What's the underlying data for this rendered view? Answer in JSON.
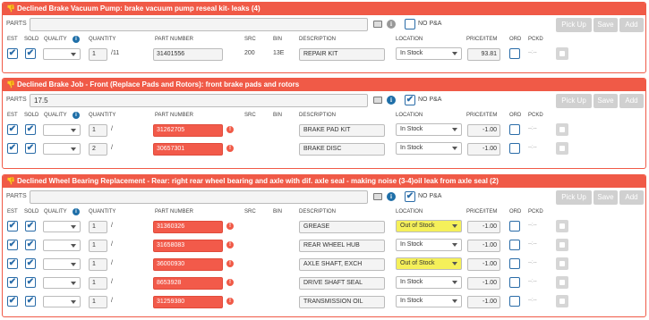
{
  "common": {
    "parts_label": "PARTS",
    "no_pa_label": "NO P&A",
    "pickup_label": "Pick Up",
    "save_label": "Save",
    "add_label": "Add",
    "col_est": "EST",
    "col_sold": "SOLD",
    "col_quality": "QUALITY",
    "col_quantity": "QUANTITY",
    "col_part_number": "PART NUMBER",
    "col_src": "SRC",
    "col_bin": "BIN",
    "col_description": "DESCRIPTION",
    "col_location": "LOCATION",
    "col_price": "PRICE/ITEM",
    "col_ord": "ORD",
    "col_pckd": "PCKD",
    "check_glyph": "✔",
    "info_glyph": "i",
    "warn_glyph": "!",
    "thumb_glyph": "👎",
    "slash": "/",
    "pckd_value": "--:--"
  },
  "panels": [
    {
      "title": "Declined  Brake Vacuum Pump: brake vacuum pump reseal kit- leaks (4)",
      "parts_value": "",
      "no_pa_checked": false,
      "rows": [
        {
          "est": true,
          "sold": true,
          "qty": "1",
          "qty_total": "/11",
          "part_number": "31401556",
          "invalid": false,
          "src": "200",
          "bin": "13E",
          "description": "REPAIR KIT",
          "location": "In Stock",
          "out_of_stock": false,
          "price": "93.81"
        }
      ]
    },
    {
      "title": "Declined  Brake Job - Front (Replace Pads and Rotors): front brake pads and rotors",
      "parts_value": "17.5",
      "no_pa_checked": true,
      "rows": [
        {
          "est": true,
          "sold": true,
          "qty": "1",
          "qty_total": "/",
          "part_number": "31262705",
          "invalid": true,
          "src": "",
          "bin": "",
          "description": "BRAKE PAD KIT",
          "location": "In Stock",
          "out_of_stock": false,
          "price": "-1.00"
        },
        {
          "est": true,
          "sold": true,
          "qty": "2",
          "qty_total": "/",
          "part_number": "30657301",
          "invalid": true,
          "src": "",
          "bin": "",
          "description": "BRAKE DISC",
          "location": "In Stock",
          "out_of_stock": false,
          "price": "-1.00"
        }
      ]
    },
    {
      "title": "Declined  Wheel Bearing Replacement - Rear: right rear wheel bearing and axle with dif. axle seal - making noise (3-4)oil leak from axle seal (2)",
      "parts_value": "",
      "no_pa_checked": true,
      "rows": [
        {
          "est": true,
          "sold": true,
          "qty": "1",
          "qty_total": "/",
          "part_number": "31360326",
          "invalid": true,
          "src": "",
          "bin": "",
          "description": "GREASE",
          "location": "Out of Stock",
          "out_of_stock": true,
          "price": "-1.00"
        },
        {
          "est": true,
          "sold": true,
          "qty": "1",
          "qty_total": "/",
          "part_number": "31658083",
          "invalid": true,
          "src": "",
          "bin": "",
          "description": "REAR WHEEL HUB",
          "location": "In Stock",
          "out_of_stock": false,
          "price": "-1.00"
        },
        {
          "est": true,
          "sold": true,
          "qty": "1",
          "qty_total": "/",
          "part_number": "36000930",
          "invalid": true,
          "src": "",
          "bin": "",
          "description": "AXLE SHAFT, EXCH",
          "location": "Out of Stock",
          "out_of_stock": true,
          "price": "-1.00"
        },
        {
          "est": true,
          "sold": true,
          "qty": "1",
          "qty_total": "/",
          "part_number": "8653928",
          "invalid": true,
          "src": "",
          "bin": "",
          "description": "DRIVE SHAFT SEAL",
          "location": "In Stock",
          "out_of_stock": false,
          "price": "-1.00"
        },
        {
          "est": true,
          "sold": true,
          "qty": "1",
          "qty_total": "/",
          "part_number": "31259380",
          "invalid": true,
          "src": "",
          "bin": "",
          "description": "TRANSMISSION OIL",
          "location": "In Stock",
          "out_of_stock": false,
          "price": "-1.00"
        }
      ]
    }
  ]
}
